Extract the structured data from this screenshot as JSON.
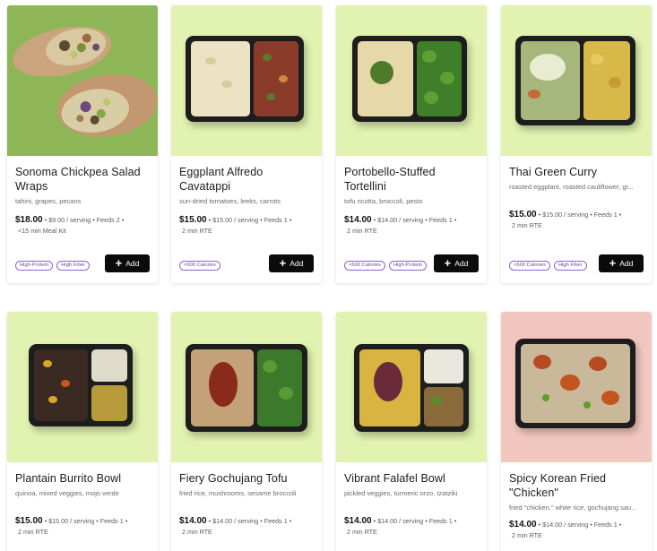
{
  "colors": {
    "photo_bg_green": "#e2f2b0",
    "photo_bg_olive": "#8eb556",
    "photo_bg_pink": "#f2c7bf",
    "add_button": "#0b0b0b",
    "tag_border": "#8b62d2"
  },
  "add_label": "Add",
  "meals": [
    {
      "title": "Sonoma Chickpea Salad Wraps",
      "description": "tahini, grapes, pecans",
      "price": "$18.00",
      "details": "• $9.00 / serving • Feeds 2 •",
      "details2": "<15 min Meal Kit",
      "tags": [
        "High-Protein",
        "High Fiber"
      ],
      "image": "chickpea-wrap-photo"
    },
    {
      "title": "Eggplant Alfredo Cavatappi",
      "description": "sun-dried tomatoes, leeks, carrots",
      "price": "$15.00",
      "details": "• $15.00 / serving • Feeds 1 •",
      "details2": "2 min RTE",
      "tags": [
        "<600 Calories"
      ],
      "image": "cavatappi-tray-photo"
    },
    {
      "title": "Portobello-Stuffed Tortellini",
      "description": "tofu ricotta, broccoli, pesto",
      "price": "$14.00",
      "details": "• $14.00 / serving • Feeds 1 •",
      "details2": "2 min RTE",
      "tags": [
        "<600 Calories",
        "High-Protein"
      ],
      "image": "tortellini-tray-photo"
    },
    {
      "title": "Thai Green Curry",
      "description": "roasted eggplant, roasted cauliflower, gr...",
      "price": "$15.00",
      "details": "• $15.00 / serving • Feeds 1 •",
      "details2": "2 min RTE",
      "tags": [
        "<600 Calories",
        "High Fiber"
      ],
      "image": "green-curry-tray-photo"
    },
    {
      "title": "Plantain Burrito Bowl",
      "description": "quinoa, mixed veggies, mojo verde",
      "price": "$15.00",
      "details": "• $15.00 / serving • Feeds 1 •",
      "details2": "2 min RTE",
      "tags": [],
      "image": "burrito-bowl-tray-photo"
    },
    {
      "title": "Fiery Gochujang Tofu",
      "description": "fried rice, mushrooms, sesame broccoli",
      "price": "$14.00",
      "details": "• $14.00 / serving • Feeds 1 •",
      "details2": "2 min RTE",
      "tags": [],
      "image": "gochujang-tofu-tray-photo"
    },
    {
      "title": "Vibrant Falafel Bowl",
      "description": "pickled veggies, turmeric orzo, tzatziki",
      "price": "$14.00",
      "details": "• $14.00 / serving • Feeds 1 •",
      "details2": "2 min RTE",
      "tags": [],
      "image": "falafel-bowl-tray-photo"
    },
    {
      "title": "Spicy Korean Fried \"Chicken\"",
      "description": "fried \"chicken,\" white rice, gochujang sau...",
      "price": "$14.00",
      "details": "• $14.00 / serving • Feeds 1 •",
      "details2": "2 min RTE",
      "tags": [],
      "image": "korean-chicken-tray-photo"
    }
  ]
}
